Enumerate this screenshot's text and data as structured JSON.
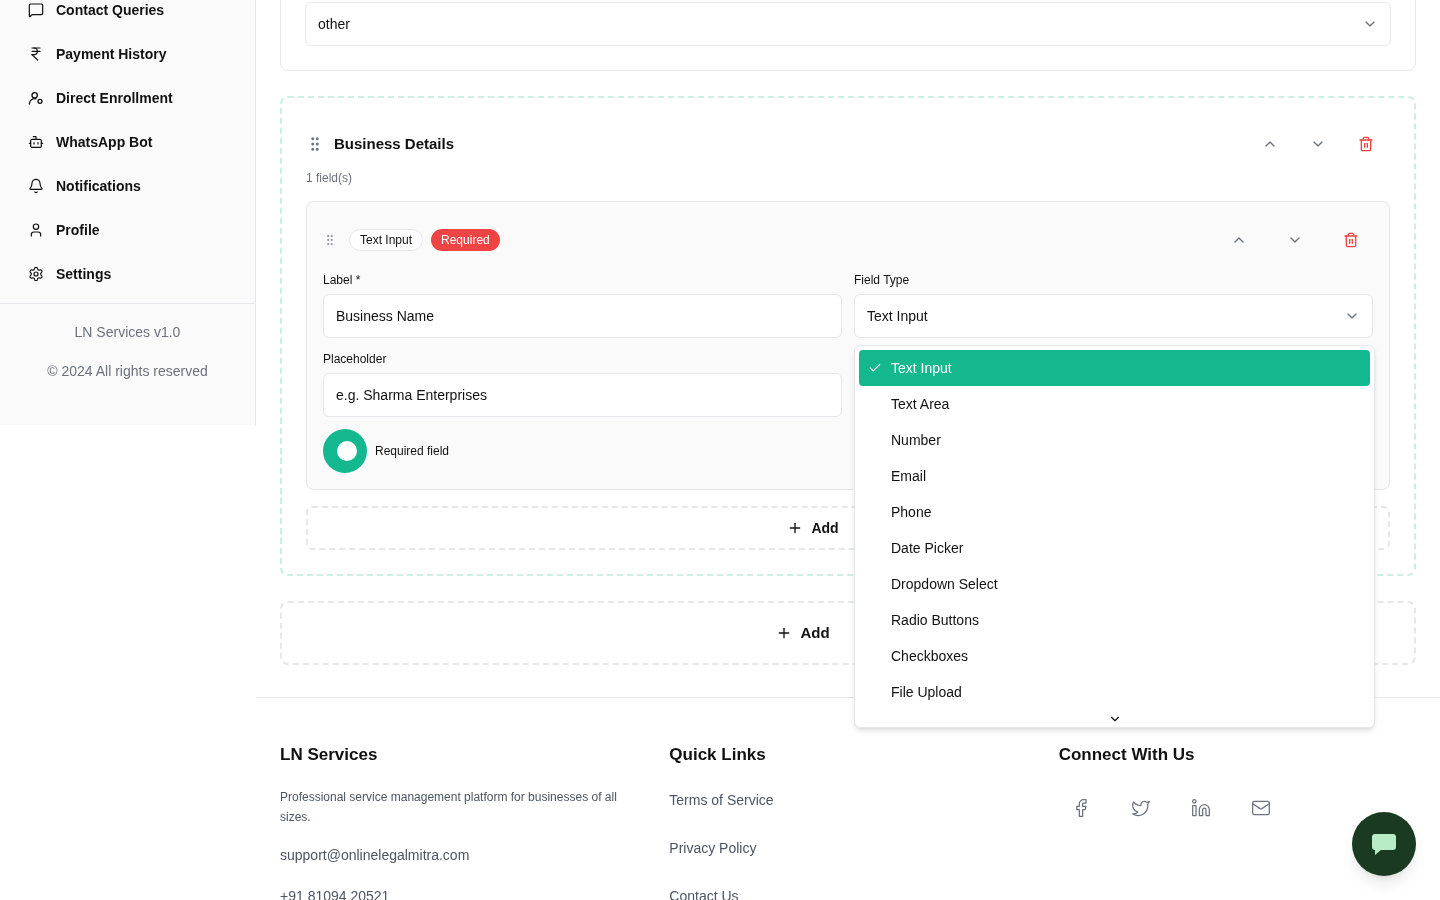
{
  "sidebar": {
    "items": [
      {
        "label": "Contact Queries"
      },
      {
        "label": "Payment History"
      },
      {
        "label": "Direct Enrollment"
      },
      {
        "label": "WhatsApp Bot"
      },
      {
        "label": "Notifications"
      },
      {
        "label": "Profile"
      },
      {
        "label": "Settings"
      }
    ],
    "version": "LN Services v1.0",
    "copyright": "© 2024 All rights reserved"
  },
  "top_select": {
    "value": "other"
  },
  "section": {
    "title": "Business Details",
    "count": "1 field(s)",
    "field": {
      "type_badge": "Text Input",
      "required_badge": "Required",
      "label_label": "Label *",
      "label_value": "Business Name",
      "type_label": "Field Type",
      "type_value": "Text Input",
      "placeholder_label": "Placeholder",
      "placeholder_value": "e.g. Sharma Enterprises",
      "required_toggle": {
        "label": "Required field",
        "on": true
      }
    },
    "add_field": "Add"
  },
  "add_section": "Add",
  "type_menu": {
    "options": [
      {
        "label": "Text Input",
        "selected": true
      },
      {
        "label": "Text Area",
        "selected": false
      },
      {
        "label": "Number",
        "selected": false
      },
      {
        "label": "Email",
        "selected": false
      },
      {
        "label": "Phone",
        "selected": false
      },
      {
        "label": "Date Picker",
        "selected": false
      },
      {
        "label": "Dropdown Select",
        "selected": false
      },
      {
        "label": "Radio Buttons",
        "selected": false
      },
      {
        "label": "Checkboxes",
        "selected": false
      },
      {
        "label": "File Upload",
        "selected": false
      }
    ]
  },
  "footer": {
    "brand": "LN Services",
    "about": "Professional service management platform for businesses of all sizes.",
    "email": "support@onlinelegalmitra.com",
    "phone": "+91 81094 20521",
    "links_title": "Quick Links",
    "links": [
      "Terms of Service",
      "Privacy Policy",
      "Contact Us"
    ],
    "social_title": "Connect With Us"
  }
}
